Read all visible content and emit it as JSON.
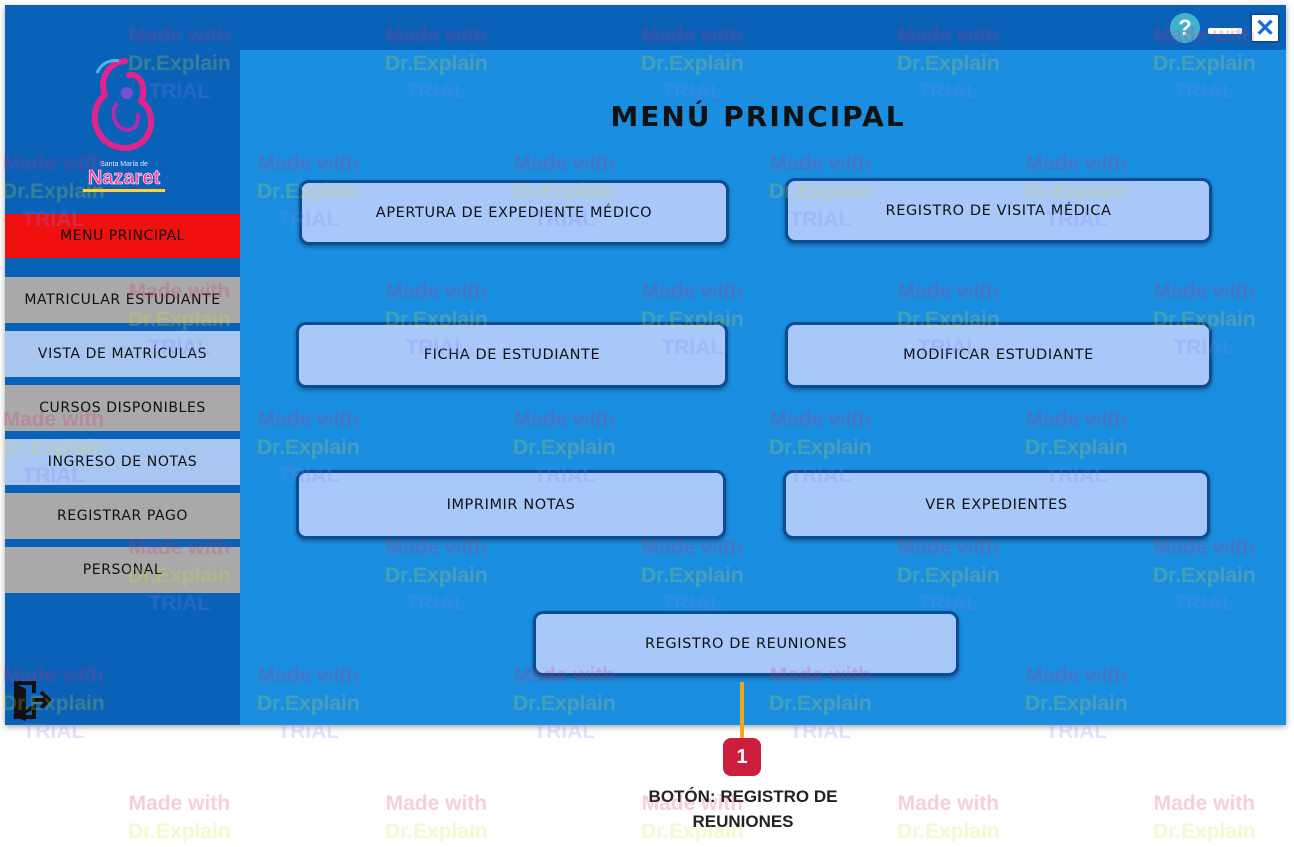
{
  "window": {
    "controls": {
      "help_symbol": "?",
      "close_symbol": "✕"
    }
  },
  "sidebar": {
    "logo": {
      "text_small": "Santa María de",
      "text_main": "Nazaret",
      "icon": "mother-child-logo"
    },
    "active_item": "MENU PRINCIPAL",
    "items": [
      {
        "label": "MATRICULAR ESTUDIANTE",
        "style": "gray"
      },
      {
        "label": "VISTA DE MATRÍCULAS",
        "style": "light"
      },
      {
        "label": "CURSOS DISPONIBLES",
        "style": "gray"
      },
      {
        "label": "INGRESO DE NOTAS",
        "style": "light"
      },
      {
        "label": "REGISTRAR PAGO",
        "style": "gray"
      },
      {
        "label": "PERSONAL",
        "style": "gray"
      }
    ],
    "exit_icon": "exit-door-icon"
  },
  "main": {
    "title": "MENÚ PRINCIPAL",
    "buttons": {
      "apertura": "APERTURA DE EXPEDIENTE MÉDICO",
      "visita": "REGISTRO DE VISITA MÉDICA",
      "ficha": "FICHA DE ESTUDIANTE",
      "modificar": "MODIFICAR ESTUDIANTE",
      "imprimir": "IMPRIMIR NOTAS",
      "expedientes": "VER EXPEDIENTES",
      "reuniones": "REGISTRO DE REUNIONES"
    }
  },
  "callout": {
    "number": "1",
    "line1": "BOTÓN: REGISTRO DE",
    "line2": "REUNIONES"
  },
  "watermark": {
    "line1": "Made with",
    "line2": "Dr.Explain",
    "line3": "TRIAL"
  },
  "colors": {
    "frame": "#0a62b8",
    "main_bg": "#1a8ee0",
    "active_menu": "#f01010",
    "button_fill": "#a8c8fa",
    "button_border": "#0b4c94",
    "nav_gray": "#a9a9a9",
    "nav_light": "#a8c6f2",
    "callout_badge": "#cc1e3c",
    "callout_line": "#f2a71e"
  }
}
